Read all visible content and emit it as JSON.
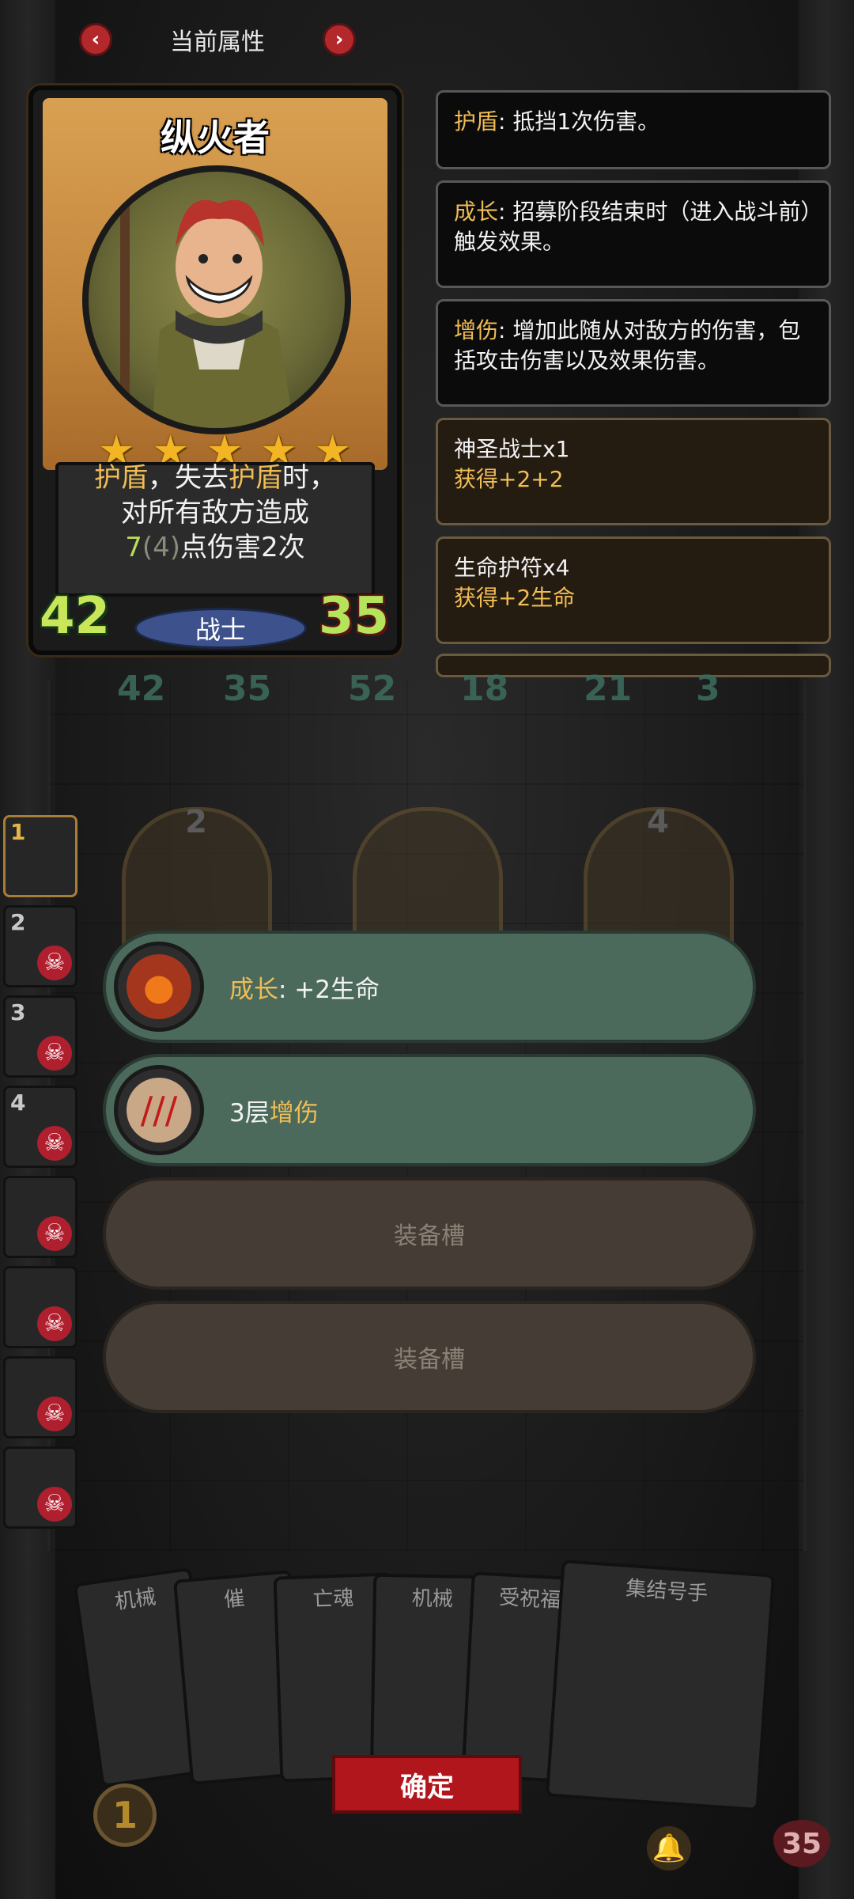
{
  "header": {
    "title": "当前属性",
    "prev_icon": "chevron-left-icon",
    "next_icon": "chevron-right-icon"
  },
  "card": {
    "name": "纵火者",
    "stars": 5,
    "desc": {
      "kw1": "护盾",
      "sep1": "，失去",
      "kw2": "护盾",
      "sep2": "时，",
      "line2": "对所有敌方造成",
      "num": "7",
      "base": "(4)",
      "tail": "点伤害2次"
    },
    "attack": "42",
    "hp": "35",
    "class": "战士"
  },
  "info_panels": [
    {
      "label": "护盾",
      "text": ": 抵挡1次伤害。"
    },
    {
      "label": "成长",
      "text": ": 招募阶段结束时（进入战斗前）触发效果。"
    },
    {
      "label": "增伤",
      "text": ": 增加此随从对敌方的伤害，包括攻击伤害以及效果伤害。"
    },
    {
      "line1": "神圣战士x1",
      "line2": "获得+2+2"
    },
    {
      "line1": "生命护符x4",
      "line2": "获得+2生命"
    }
  ],
  "board_stats": [
    "42",
    "35",
    "52",
    "18",
    "21",
    "3"
  ],
  "board_units": [
    "2",
    "4"
  ],
  "roster": [
    "1",
    "2",
    "3",
    "4"
  ],
  "slots": [
    {
      "kind": "filled",
      "label": "成长",
      "text": ": +2生命",
      "icon": "pumpkin-icon"
    },
    {
      "kind": "filled",
      "prefix": "3层",
      "label": "增伤",
      "icon": "claw-icon"
    },
    {
      "kind": "empty",
      "text": "装备槽"
    },
    {
      "kind": "empty",
      "text": "装备槽"
    }
  ],
  "hand": {
    "cards": [
      "机械",
      "催",
      "亡魂",
      "机械",
      "受祝福",
      "集结号手"
    ],
    "confirm": "确定",
    "coin": "1",
    "hero_hp": "35"
  },
  "colors": {
    "accent_gold": "#f0bd55",
    "confirm_red": "#b1161d",
    "slot_green": "#4b6a5c"
  }
}
